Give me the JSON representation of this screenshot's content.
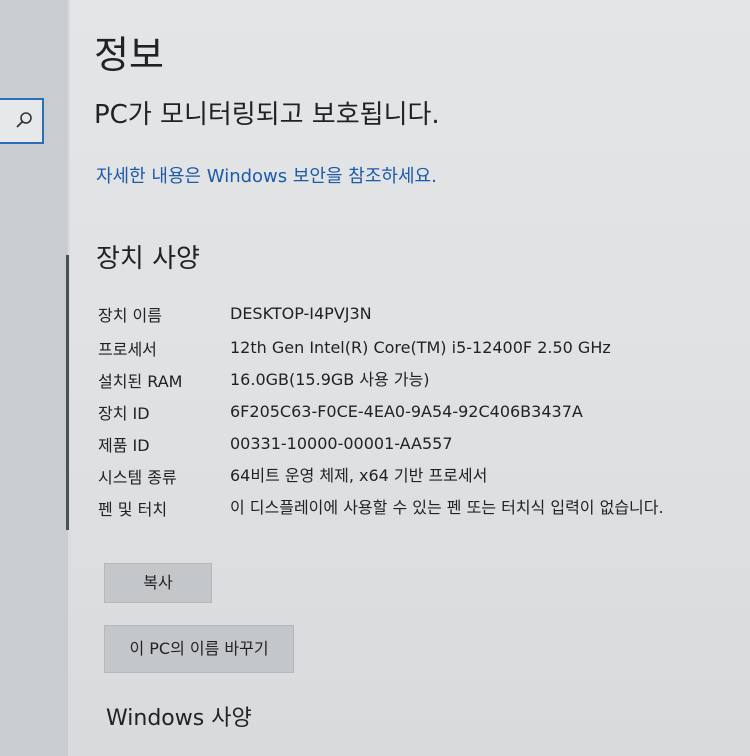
{
  "page": {
    "title": "정보",
    "status": "PC가 모니터링되고 보호됩니다.",
    "security_link": "자세한 내용은 Windows 보안을 참조하세요."
  },
  "device_specs": {
    "title": "장치 사양",
    "rows": [
      {
        "label": "장치 이름",
        "value": "DESKTOP-I4PVJ3N"
      },
      {
        "label": "프로세서",
        "value": "12th Gen Intel(R) Core(TM) i5-12400F   2.50 GHz"
      },
      {
        "label": "설치된 RAM",
        "value": "16.0GB(15.9GB 사용 가능)"
      },
      {
        "label": "장치 ID",
        "value": "6F205C63-F0CE-4EA0-9A54-92C406B3437A"
      },
      {
        "label": "제품 ID",
        "value": "00331-10000-00001-AA557"
      },
      {
        "label": "시스템 종류",
        "value": "64비트 운영 체제, x64 기반 프로세서"
      },
      {
        "label": "펜 및 터치",
        "value": "이 디스플레이에 사용할 수 있는 펜 또는 터치식 입력이 없습니다."
      }
    ]
  },
  "buttons": {
    "copy": "복사",
    "rename": "이 PC의 이름 바꾸기"
  },
  "windows_specs": {
    "title": "Windows 사양"
  },
  "icons": {
    "search": "search-icon"
  }
}
